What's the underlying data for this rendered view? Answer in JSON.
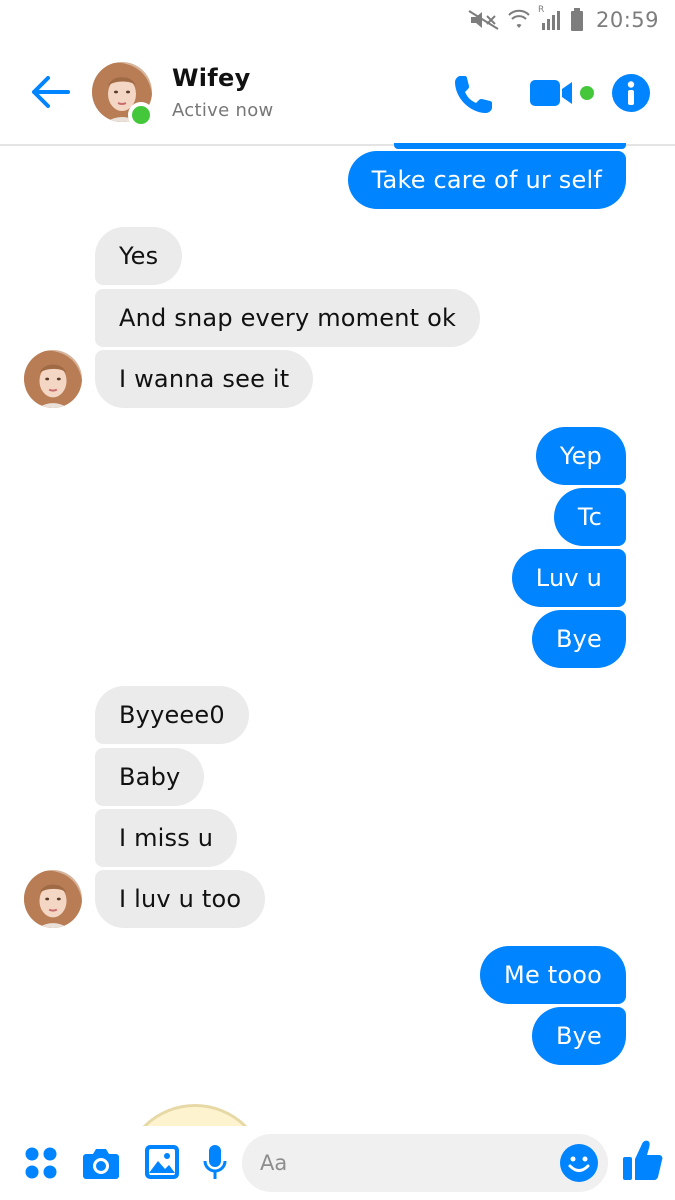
{
  "status_bar": {
    "time": "20:59",
    "signal_badge": "R"
  },
  "header": {
    "contact_name": "Wifey",
    "contact_status": "Active now"
  },
  "messages": [
    {
      "dir": "out",
      "text": "Take care of ur self"
    },
    {
      "dir": "in",
      "text": "Yes"
    },
    {
      "dir": "in",
      "text": "And snap every moment ok"
    },
    {
      "dir": "in",
      "text": "I wanna see it"
    },
    {
      "dir": "out",
      "text": "Yep"
    },
    {
      "dir": "out",
      "text": "Tc"
    },
    {
      "dir": "out",
      "text": "Luv u"
    },
    {
      "dir": "out",
      "text": "Bye"
    },
    {
      "dir": "in",
      "text": "Byyeee0"
    },
    {
      "dir": "in",
      "text": "Baby"
    },
    {
      "dir": "in",
      "text": "I miss u"
    },
    {
      "dir": "in",
      "text": "I luv u too"
    },
    {
      "dir": "out",
      "text": "Me tooo"
    },
    {
      "dir": "out",
      "text": "Bye"
    }
  ],
  "composer": {
    "placeholder": "Aa"
  },
  "colors": {
    "accent": "#0084ff",
    "incoming_bubble": "#ebebeb",
    "active_green": "#44c73b"
  },
  "icons": [
    "back-arrow-icon",
    "phone-icon",
    "video-camera-icon",
    "info-icon",
    "apps-grid-icon",
    "camera-icon",
    "gallery-icon",
    "microphone-icon",
    "emoji-icon",
    "thumbs-up-icon"
  ]
}
